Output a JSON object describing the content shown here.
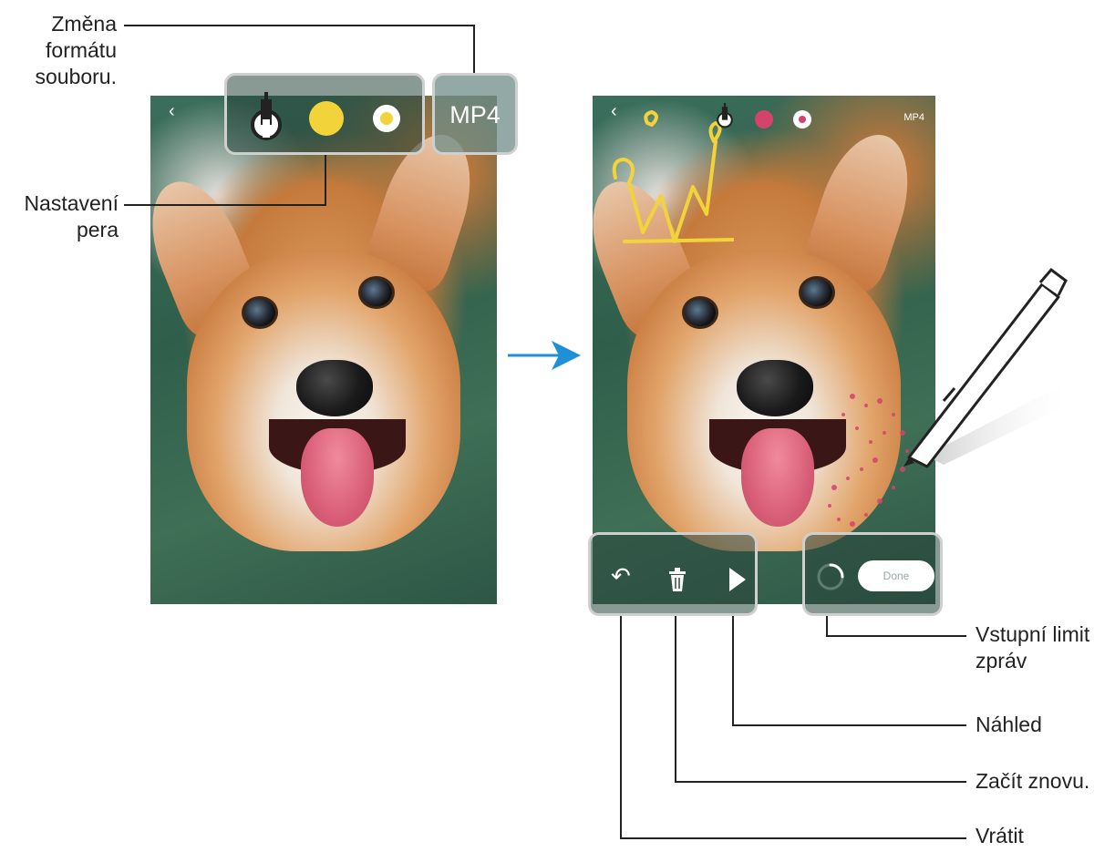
{
  "callouts": {
    "file_format": "Změna\nformátu\nsouboru.",
    "pen_settings": "Nastavení\npera",
    "input_limit": "Vstupní limit\nzpráv",
    "preview": "Náhled",
    "start_over": "Začít znovu.",
    "undo": "Vrátit"
  },
  "left_screen": {
    "format_label": "MP4",
    "back_glyph": "‹",
    "pen_color": "#f2d33a"
  },
  "right_screen": {
    "format_label": "MP4",
    "back_glyph": "‹",
    "pen_color": "#d6436a",
    "done_label": "Done",
    "undo_glyph": "↶",
    "trash_glyph": "🗑",
    "play_glyph": "▶"
  },
  "colors": {
    "arrow": "#1f8fd6",
    "callout_line": "#222222",
    "overlay_border": "#cfcfcf"
  }
}
